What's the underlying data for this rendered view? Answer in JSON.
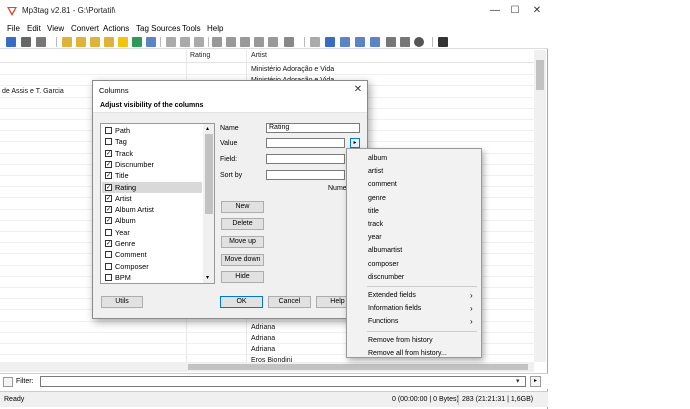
{
  "window": {
    "title": "Mp3tag v2.81 - G:\\Portatil\\",
    "minimize_glyph": "—",
    "maximize_glyph": "☐",
    "close_glyph": "✕"
  },
  "menu": [
    "File",
    "Edit",
    "View",
    "Convert",
    "Actions",
    "Tag Sources",
    "Tools",
    "Help"
  ],
  "grid": {
    "headers": {
      "rating": "Rating",
      "artist": "Artist"
    },
    "left_cells": [
      "",
      "",
      "de Assis e T. Garcia"
    ],
    "artist_cells_top": [
      "Ministério Adoração e Vida",
      "Ministério Adoração e Vida"
    ],
    "artist_cells_bottom": [
      "Adriana",
      "Adriana",
      "Adriana",
      "Eros Biondini"
    ]
  },
  "filter": {
    "label": "Filter:",
    "value": ""
  },
  "status": {
    "left": "Ready",
    "selection": "0 (00:00:00 | 0 Bytes)",
    "total": "283 (21:21:31 | 1,6GB)"
  },
  "dialog": {
    "title": "Columns",
    "close_glyph": "✕",
    "header": "Adjust visibility of the columns",
    "columns": [
      {
        "label": "Path",
        "checked": false
      },
      {
        "label": "Tag",
        "checked": false
      },
      {
        "label": "Track",
        "checked": true
      },
      {
        "label": "Discnumber",
        "checked": true
      },
      {
        "label": "Title",
        "checked": true
      },
      {
        "label": "Rating",
        "checked": true,
        "selected": true
      },
      {
        "label": "Artist",
        "checked": true
      },
      {
        "label": "Album Artist",
        "checked": true
      },
      {
        "label": "Album",
        "checked": true
      },
      {
        "label": "Year",
        "checked": false
      },
      {
        "label": "Genre",
        "checked": true
      },
      {
        "label": "Comment",
        "checked": false
      },
      {
        "label": "Composer",
        "checked": false
      },
      {
        "label": "BPM",
        "checked": false
      }
    ],
    "fields": {
      "name_label": "Name",
      "name_value": "Rating",
      "value_label": "Value",
      "value_value": "",
      "field_label": "Field:",
      "field_value": "",
      "sortby_label": "Sort by",
      "sortby_value": "",
      "numeric_label": "Numeri"
    },
    "buttons": {
      "new": "New",
      "delete": "Delete",
      "move_up": "Move up",
      "move_down": "Move down",
      "hide": "Hide",
      "utils": "Utils",
      "ok": "OK",
      "cancel": "Cancel",
      "help": "Help"
    }
  },
  "context_menu": {
    "placeholders": [
      "album",
      "artist",
      "comment",
      "genre",
      "title",
      "track",
      "year",
      "albumartist",
      "composer",
      "discnumber"
    ],
    "submenus": [
      "Extended fields",
      "Information fields",
      "Functions"
    ],
    "history": [
      "Remove from history",
      "Remove all from history..."
    ],
    "submenu_arrow": "›"
  },
  "colors": {
    "accent": "#0078d7",
    "selection": "#d9d9d9",
    "dialog_bg": "#f0f0f0"
  }
}
